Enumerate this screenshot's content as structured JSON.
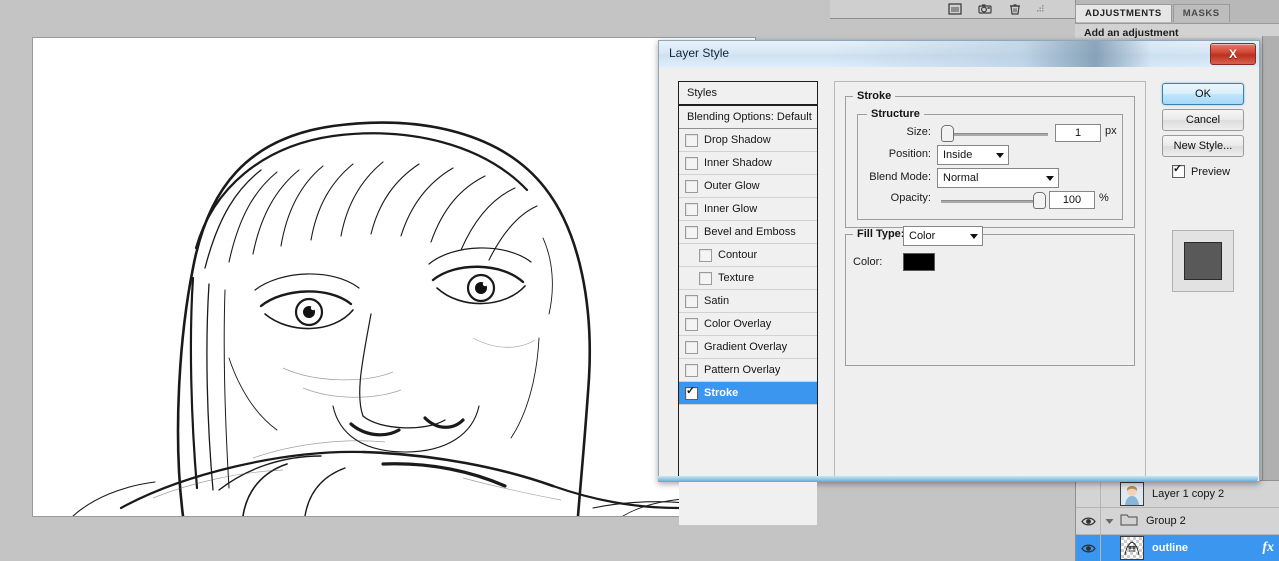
{
  "app": {
    "toolbar_icons": [
      "panel-icon",
      "camera-icon",
      "trash-icon"
    ]
  },
  "adjustments_panel": {
    "tabs": [
      {
        "label": "ADJUSTMENTS",
        "active": true
      },
      {
        "label": "MASKS",
        "active": false
      }
    ],
    "heading": "Add an adjustment"
  },
  "layers_panel": {
    "rows": [
      {
        "name": "Layer 1 copy 2",
        "selected": false,
        "type": "layer",
        "eye": false,
        "fx": false
      },
      {
        "name": "Group 2",
        "selected": false,
        "type": "group",
        "eye": true,
        "fx": false
      },
      {
        "name": "outline",
        "selected": true,
        "type": "layer",
        "eye": true,
        "fx": true
      }
    ],
    "fx_glyph": "fx"
  },
  "dialog": {
    "title": "Layer Style",
    "close_label": "X",
    "styles": {
      "header": "Styles",
      "blending_options": "Blending Options: Default",
      "items": [
        {
          "label": "Drop Shadow",
          "checked": false,
          "indent": false,
          "selected": false
        },
        {
          "label": "Inner Shadow",
          "checked": false,
          "indent": false,
          "selected": false
        },
        {
          "label": "Outer Glow",
          "checked": false,
          "indent": false,
          "selected": false
        },
        {
          "label": "Inner Glow",
          "checked": false,
          "indent": false,
          "selected": false
        },
        {
          "label": "Bevel and Emboss",
          "checked": false,
          "indent": false,
          "selected": false
        },
        {
          "label": "Contour",
          "checked": false,
          "indent": true,
          "selected": false
        },
        {
          "label": "Texture",
          "checked": false,
          "indent": true,
          "selected": false
        },
        {
          "label": "Satin",
          "checked": false,
          "indent": false,
          "selected": false
        },
        {
          "label": "Color Overlay",
          "checked": false,
          "indent": false,
          "selected": false
        },
        {
          "label": "Gradient Overlay",
          "checked": false,
          "indent": false,
          "selected": false
        },
        {
          "label": "Pattern Overlay",
          "checked": false,
          "indent": false,
          "selected": false
        },
        {
          "label": "Stroke",
          "checked": true,
          "indent": false,
          "selected": true
        }
      ]
    },
    "stroke": {
      "group_title": "Stroke",
      "structure": {
        "group_title": "Structure",
        "size_label": "Size:",
        "size_value": "1",
        "size_unit": "px",
        "size_slider_pct": 0,
        "position_label": "Position:",
        "position_value": "Inside",
        "blend_mode_label": "Blend Mode:",
        "blend_mode_value": "Normal",
        "opacity_label": "Opacity:",
        "opacity_value": "100",
        "opacity_unit": "%",
        "opacity_slider_pct": 100
      },
      "fill": {
        "fill_type_label": "Fill Type:",
        "fill_type_value": "Color",
        "color_label": "Color:",
        "color_value": "#000000"
      }
    },
    "buttons": {
      "ok": "OK",
      "cancel": "Cancel",
      "new_style": "New Style...",
      "preview_label": "Preview",
      "preview_checked": true
    }
  },
  "colors": {
    "accent_selection": "#3b96f0",
    "dialog_bg": "#efefef",
    "app_bg": "#c4c4c4",
    "stroke_color": "#000000",
    "close_button": "#cf4231"
  }
}
